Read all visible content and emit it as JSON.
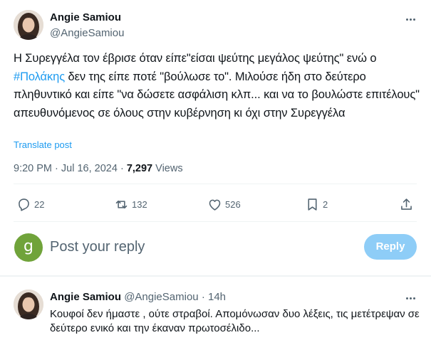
{
  "main_tweet": {
    "author_name": "Angie Samiou",
    "author_handle": "@AngieSamiou",
    "text_part1": "Η Συρεγγέλα τον έβρισε όταν είπε\"είσαι ψεύτης μεγάλος ψεύτης\" ενώ ο ",
    "hashtag": "#Πολάκης",
    "text_part2": " δεν της είπε ποτέ \"βούλωσε το\". Μιλούσε ήδη στο δεύτερο πληθυντικό και είπε \"να δώσετε ασφάλιση κλπ... και να το βουλώστε επιτέλους\" απευθυνόμενος σε όλους στην κυβέρνηση κι όχι στην Συρεγγέλα",
    "translate_label": "Translate post",
    "time": "9:20 PM",
    "dot": "·",
    "date": "Jul 16, 2024",
    "views_count": "7,297",
    "views_label": "Views",
    "stats": {
      "replies": "22",
      "reposts": "132",
      "likes": "526",
      "bookmarks": "2"
    },
    "icons": [
      "more-icon",
      "reply-icon",
      "retweet-icon",
      "heart-icon",
      "bookmark-icon",
      "share-icon"
    ]
  },
  "composer": {
    "avatar_letter": "g",
    "placeholder": "Post your reply",
    "reply_button": "Reply",
    "accent_color": "#1d9bf0"
  },
  "reply_tweet": {
    "author_name": "Angie Samiou",
    "author_handle": "@AngieSamiou",
    "dot": "·",
    "time_ago": "14h",
    "text": "Κουφοί δεν ήμαστε , ούτε στραβοί. Απομόνωσαν δυο λέξεις, τις μετέτρεψαν σε δεύτερο ενικό και την έκαναν πρωτοσέλιδο..."
  }
}
